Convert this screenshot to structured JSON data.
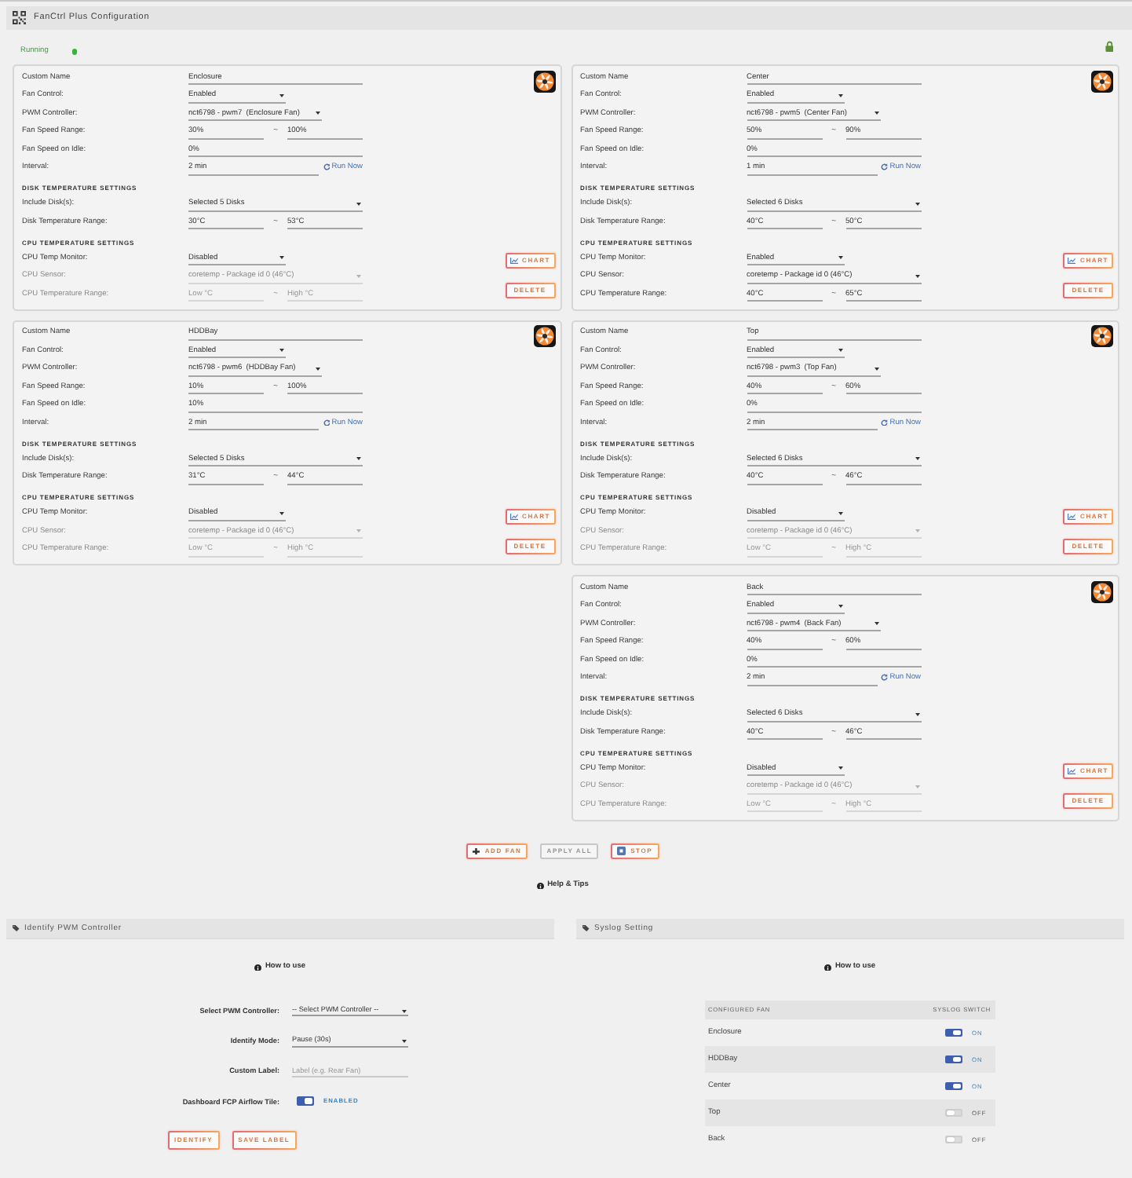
{
  "title_bar": {
    "title": "FanCtrl Plus Configuration"
  },
  "status": {
    "label": "Running",
    "running": true
  },
  "fan_columns": [
    {
      "fans": [
        {
          "sections": [
            {
              "rows": [
                {
                  "kind": "text",
                  "label": "Custom Name",
                  "value": "Enclosure",
                  "disabled": false
                },
                {
                  "kind": "short-select",
                  "label": "Fan Control:",
                  "value": "Enabled",
                  "disabled": false
                },
                {
                  "kind": "pwm-select",
                  "label": "PWM Controller:",
                  "value": "nct6798 - pwm7  (Enclosure Fan)",
                  "disabled": false
                },
                {
                  "kind": "range",
                  "label": "Fan Speed Range:",
                  "low": {
                    "value": "30%"
                  },
                  "separator": "~",
                  "high": {
                    "value": "100%"
                  },
                  "disabled": false
                },
                {
                  "kind": "text",
                  "label": "Fan Speed on Idle:",
                  "value": "0%",
                  "disabled": false
                },
                {
                  "kind": "interval",
                  "label": "Interval:",
                  "value": "2 min",
                  "action": "Run Now",
                  "disabled": false
                }
              ]
            },
            {
              "title": "DISK TEMPERATURE SETTINGS",
              "rows": [
                {
                  "kind": "select",
                  "label": "Include Disk(s):",
                  "value": "Selected 5 Disks",
                  "disabled": false
                },
                {
                  "kind": "range",
                  "label": "Disk Temperature Range:",
                  "low": {
                    "value": "30°C"
                  },
                  "separator": "~",
                  "high": {
                    "value": "53°C"
                  },
                  "disabled": false
                }
              ]
            },
            {
              "title": "CPU TEMPERATURE SETTINGS",
              "rows": [
                {
                  "kind": "short-select",
                  "label": "CPU Temp Monitor:",
                  "value": "Disabled",
                  "disabled": false
                },
                {
                  "kind": "select",
                  "label": "CPU Sensor:",
                  "value": "coretemp - Package id 0 (46°C)",
                  "disabled": true
                },
                {
                  "kind": "range",
                  "label": "CPU Temperature Range:",
                  "low": {
                    "placeholder": "Low °C"
                  },
                  "separator": "~",
                  "high": {
                    "placeholder": "High °C"
                  },
                  "disabled": true
                }
              ]
            }
          ],
          "buttons": [
            {
              "kind": "chart",
              "label": "CHART"
            },
            {
              "kind": "delete",
              "label": "DELETE"
            }
          ]
        },
        {
          "sections": [
            {
              "rows": [
                {
                  "kind": "text",
                  "label": "Custom Name",
                  "value": "HDDBay",
                  "disabled": false
                },
                {
                  "kind": "short-select",
                  "label": "Fan Control:",
                  "value": "Enabled",
                  "disabled": false
                },
                {
                  "kind": "pwm-select",
                  "label": "PWM Controller:",
                  "value": "nct6798 - pwm6  (HDDBay Fan)",
                  "disabled": false
                },
                {
                  "kind": "range",
                  "label": "Fan Speed Range:",
                  "low": {
                    "value": "10%"
                  },
                  "separator": "~",
                  "high": {
                    "value": "100%"
                  },
                  "disabled": false
                },
                {
                  "kind": "text",
                  "label": "Fan Speed on Idle:",
                  "value": "10%",
                  "disabled": false
                },
                {
                  "kind": "interval",
                  "label": "Interval:",
                  "value": "2 min",
                  "action": "Run Now",
                  "disabled": false
                }
              ]
            },
            {
              "title": "DISK TEMPERATURE SETTINGS",
              "rows": [
                {
                  "kind": "select",
                  "label": "Include Disk(s):",
                  "value": "Selected 5 Disks",
                  "disabled": false
                },
                {
                  "kind": "range",
                  "label": "Disk Temperature Range:",
                  "low": {
                    "value": "31°C"
                  },
                  "separator": "~",
                  "high": {
                    "value": "44°C"
                  },
                  "disabled": false
                }
              ]
            },
            {
              "title": "CPU TEMPERATURE SETTINGS",
              "rows": [
                {
                  "kind": "short-select",
                  "label": "CPU Temp Monitor:",
                  "value": "Disabled",
                  "disabled": false
                },
                {
                  "kind": "select",
                  "label": "CPU Sensor:",
                  "value": "coretemp - Package id 0 (46°C)",
                  "disabled": true
                },
                {
                  "kind": "range",
                  "label": "CPU Temperature Range:",
                  "low": {
                    "placeholder": "Low °C"
                  },
                  "separator": "~",
                  "high": {
                    "placeholder": "High °C"
                  },
                  "disabled": true
                }
              ]
            }
          ],
          "buttons": [
            {
              "kind": "chart",
              "label": "CHART"
            },
            {
              "kind": "delete",
              "label": "DELETE"
            }
          ]
        }
      ]
    },
    {
      "fans": [
        {
          "sections": [
            {
              "rows": [
                {
                  "kind": "text",
                  "label": "Custom Name",
                  "value": "Center",
                  "disabled": false
                },
                {
                  "kind": "short-select",
                  "label": "Fan Control:",
                  "value": "Enabled",
                  "disabled": false
                },
                {
                  "kind": "pwm-select",
                  "label": "PWM Controller:",
                  "value": "nct6798 - pwm5  (Center Fan)",
                  "disabled": false
                },
                {
                  "kind": "range",
                  "label": "Fan Speed Range:",
                  "low": {
                    "value": "50%"
                  },
                  "separator": "~",
                  "high": {
                    "value": "90%"
                  },
                  "disabled": false
                },
                {
                  "kind": "text",
                  "label": "Fan Speed on Idle:",
                  "value": "0%",
                  "disabled": false
                },
                {
                  "kind": "interval",
                  "label": "Interval:",
                  "value": "1 min",
                  "action": "Run Now",
                  "disabled": false
                }
              ]
            },
            {
              "title": "DISK TEMPERATURE SETTINGS",
              "rows": [
                {
                  "kind": "select",
                  "label": "Include Disk(s):",
                  "value": "Selected 6 Disks",
                  "disabled": false
                },
                {
                  "kind": "range",
                  "label": "Disk Temperature Range:",
                  "low": {
                    "value": "40°C"
                  },
                  "separator": "~",
                  "high": {
                    "value": "50°C"
                  },
                  "disabled": false
                }
              ]
            },
            {
              "title": "CPU TEMPERATURE SETTINGS",
              "rows": [
                {
                  "kind": "short-select",
                  "label": "CPU Temp Monitor:",
                  "value": "Enabled",
                  "disabled": false
                },
                {
                  "kind": "select",
                  "label": "CPU Sensor:",
                  "value": "coretemp - Package id 0 (46°C)",
                  "disabled": false
                },
                {
                  "kind": "range",
                  "label": "CPU Temperature Range:",
                  "low": {
                    "value": "40°C"
                  },
                  "separator": "~",
                  "high": {
                    "value": "65°C"
                  },
                  "disabled": false
                }
              ]
            }
          ],
          "buttons": [
            {
              "kind": "chart",
              "label": "CHART"
            },
            {
              "kind": "delete",
              "label": "DELETE"
            }
          ]
        },
        {
          "sections": [
            {
              "rows": [
                {
                  "kind": "text",
                  "label": "Custom Name",
                  "value": "Top",
                  "disabled": false
                },
                {
                  "kind": "short-select",
                  "label": "Fan Control:",
                  "value": "Enabled",
                  "disabled": false
                },
                {
                  "kind": "pwm-select",
                  "label": "PWM Controller:",
                  "value": "nct6798 - pwm3  (Top Fan)",
                  "disabled": false
                },
                {
                  "kind": "range",
                  "label": "Fan Speed Range:",
                  "low": {
                    "value": "40%"
                  },
                  "separator": "~",
                  "high": {
                    "value": "60%"
                  },
                  "disabled": false
                },
                {
                  "kind": "text",
                  "label": "Fan Speed on Idle:",
                  "value": "0%",
                  "disabled": false
                },
                {
                  "kind": "interval",
                  "label": "Interval:",
                  "value": "2 min",
                  "action": "Run Now",
                  "disabled": false
                }
              ]
            },
            {
              "title": "DISK TEMPERATURE SETTINGS",
              "rows": [
                {
                  "kind": "select",
                  "label": "Include Disk(s):",
                  "value": "Selected 6 Disks",
                  "disabled": false
                },
                {
                  "kind": "range",
                  "label": "Disk Temperature Range:",
                  "low": {
                    "value": "40°C"
                  },
                  "separator": "~",
                  "high": {
                    "value": "46°C"
                  },
                  "disabled": false
                }
              ]
            },
            {
              "title": "CPU TEMPERATURE SETTINGS",
              "rows": [
                {
                  "kind": "short-select",
                  "label": "CPU Temp Monitor:",
                  "value": "Disabled",
                  "disabled": false
                },
                {
                  "kind": "select",
                  "label": "CPU Sensor:",
                  "value": "coretemp - Package id 0 (46°C)",
                  "disabled": true
                },
                {
                  "kind": "range",
                  "label": "CPU Temperature Range:",
                  "low": {
                    "placeholder": "Low °C"
                  },
                  "separator": "~",
                  "high": {
                    "placeholder": "High °C"
                  },
                  "disabled": true
                }
              ]
            }
          ],
          "buttons": [
            {
              "kind": "chart",
              "label": "CHART"
            },
            {
              "kind": "delete",
              "label": "DELETE"
            }
          ]
        },
        {
          "sections": [
            {
              "rows": [
                {
                  "kind": "text",
                  "label": "Custom Name",
                  "value": "Back",
                  "disabled": false
                },
                {
                  "kind": "short-select",
                  "label": "Fan Control:",
                  "value": "Enabled",
                  "disabled": false
                },
                {
                  "kind": "pwm-select",
                  "label": "PWM Controller:",
                  "value": "nct6798 - pwm4  (Back Fan)",
                  "disabled": false
                },
                {
                  "kind": "range",
                  "label": "Fan Speed Range:",
                  "low": {
                    "value": "40%"
                  },
                  "separator": "~",
                  "high": {
                    "value": "60%"
                  },
                  "disabled": false
                },
                {
                  "kind": "text",
                  "label": "Fan Speed on Idle:",
                  "value": "0%",
                  "disabled": false
                },
                {
                  "kind": "interval",
                  "label": "Interval:",
                  "value": "2 min",
                  "action": "Run Now",
                  "disabled": false
                }
              ]
            },
            {
              "title": "DISK TEMPERATURE SETTINGS",
              "rows": [
                {
                  "kind": "select",
                  "label": "Include Disk(s):",
                  "value": "Selected 6 Disks",
                  "disabled": false
                },
                {
                  "kind": "range",
                  "label": "Disk Temperature Range:",
                  "low": {
                    "value": "40°C"
                  },
                  "separator": "~",
                  "high": {
                    "value": "46°C"
                  },
                  "disabled": false
                }
              ]
            },
            {
              "title": "CPU TEMPERATURE SETTINGS",
              "rows": [
                {
                  "kind": "short-select",
                  "label": "CPU Temp Monitor:",
                  "value": "Disabled",
                  "disabled": false
                },
                {
                  "kind": "select",
                  "label": "CPU Sensor:",
                  "value": "coretemp - Package id 0 (46°C)",
                  "disabled": true
                },
                {
                  "kind": "range",
                  "label": "CPU Temperature Range:",
                  "low": {
                    "placeholder": "Low °C"
                  },
                  "separator": "~",
                  "high": {
                    "placeholder": "High °C"
                  },
                  "disabled": true
                }
              ]
            }
          ],
          "buttons": [
            {
              "kind": "chart",
              "label": "CHART"
            },
            {
              "kind": "delete",
              "label": "DELETE"
            }
          ]
        }
      ]
    }
  ],
  "actions": [
    {
      "kind": "add",
      "label": "ADD FAN",
      "disabled": false
    },
    {
      "kind": "apply",
      "label": "APPLY ALL",
      "disabled": true
    },
    {
      "kind": "stop",
      "label": "STOP",
      "disabled": false
    }
  ],
  "help": {
    "label": "Help & Tips"
  },
  "identify_panel": {
    "title": "Identify PWM Controller",
    "help": "How to use",
    "fields": [
      {
        "kind": "select",
        "label": "Select PWM Controller:",
        "value": "-- Select PWM Controller --"
      },
      {
        "kind": "select",
        "label": "Identify Mode:",
        "value": "Pause (30s)"
      },
      {
        "kind": "text",
        "label": "Custom Label:",
        "placeholder": "Label (e.g. Rear Fan)"
      },
      {
        "kind": "switch",
        "label": "Dashboard FCP Airflow Tile:",
        "on": true,
        "status": "ENABLED"
      }
    ],
    "buttons": [
      "IDENTIFY",
      "SAVE LABEL"
    ]
  },
  "syslog_panel": {
    "title": "Syslog Setting",
    "help": "How to use",
    "columns": [
      "CONFIGURED FAN",
      "SYSLOG SWITCH"
    ],
    "rows": [
      {
        "fan": "Enclosure",
        "on": true,
        "status": "ON"
      },
      {
        "fan": "HDDBay",
        "on": true,
        "status": "ON"
      },
      {
        "fan": "Center",
        "on": true,
        "status": "ON"
      },
      {
        "fan": "Top",
        "on": false,
        "status": "OFF"
      },
      {
        "fan": "Back",
        "on": false,
        "status": "OFF"
      }
    ]
  }
}
